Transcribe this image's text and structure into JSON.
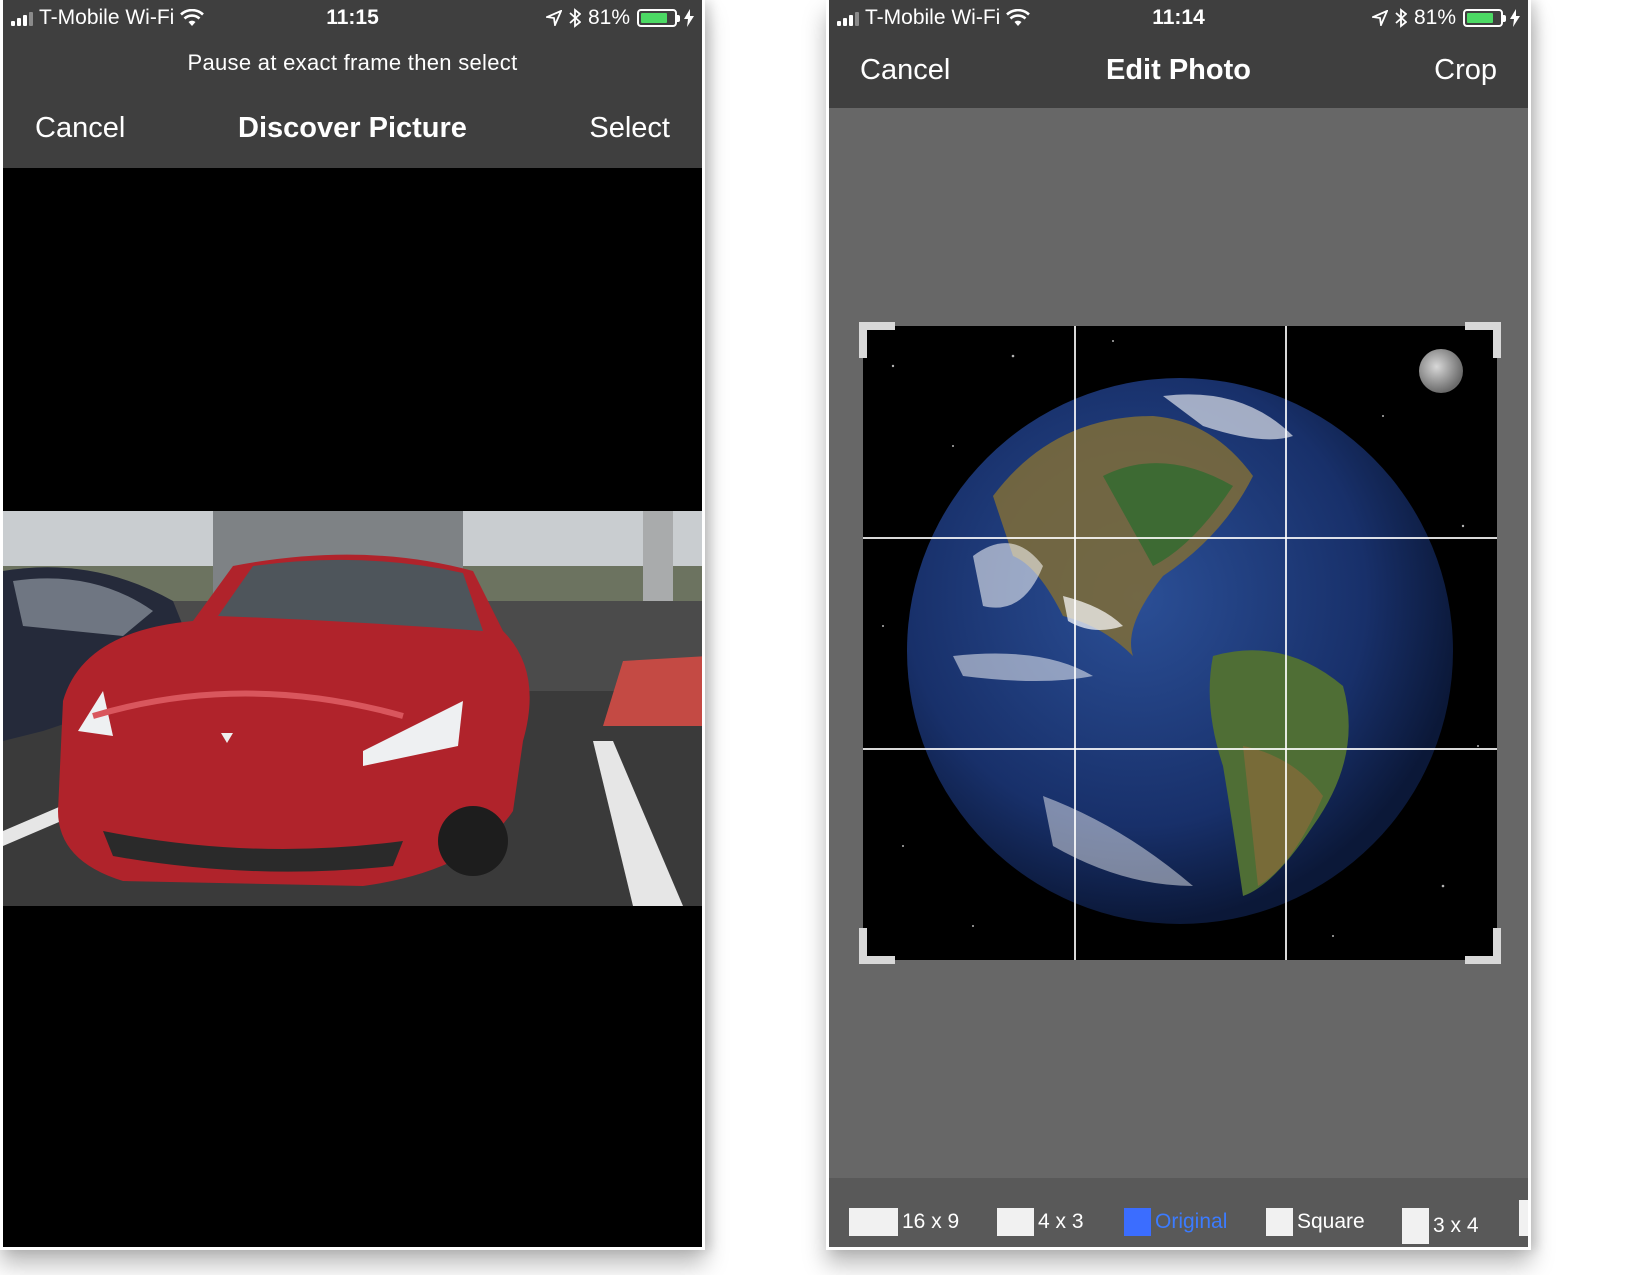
{
  "left_phone": {
    "status": {
      "carrier": "T-Mobile Wi-Fi",
      "time": "11:15",
      "battery": "81%",
      "battery_level": 0.81
    },
    "prompt": "Pause at exact frame then select",
    "nav": {
      "cancel": "Cancel",
      "title": "Discover Picture",
      "select": "Select"
    }
  },
  "right_phone": {
    "status": {
      "carrier": "T-Mobile Wi-Fi",
      "time": "11:14",
      "battery": "81%",
      "battery_level": 0.81
    },
    "nav": {
      "cancel": "Cancel",
      "title": "Edit Photo",
      "crop": "Crop"
    },
    "aspect_options": [
      "16 x 9",
      "4 x 3",
      "Original",
      "Square",
      "3 x 4"
    ],
    "selected_aspect": "Original"
  },
  "colors": {
    "accent": "#3b7bff",
    "battery": "#4cd964",
    "nav_bg": "#3f3f3f",
    "canvas_bg": "#676767"
  }
}
